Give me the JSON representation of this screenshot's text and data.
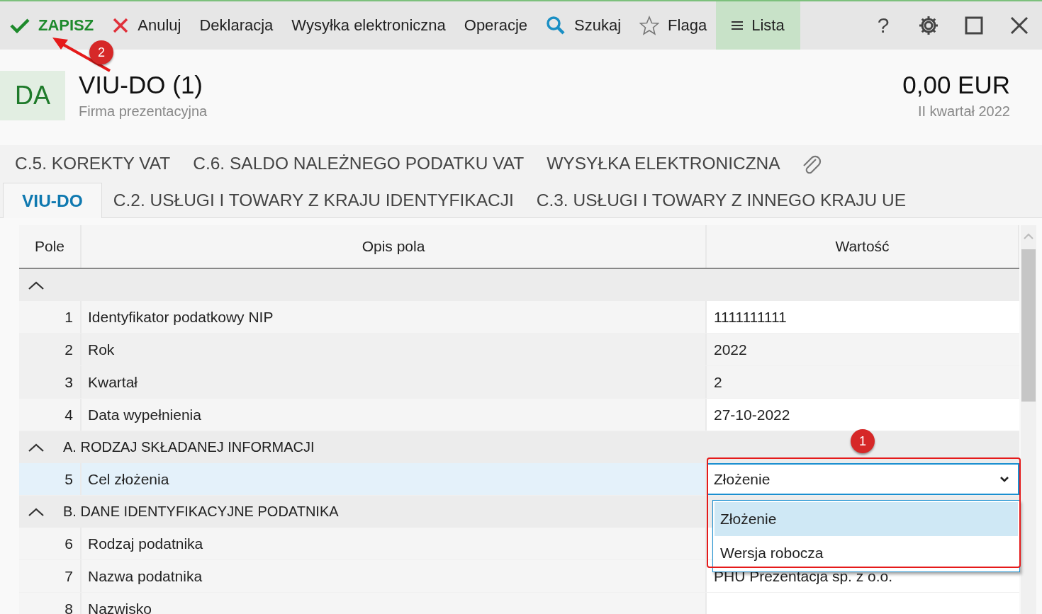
{
  "toolbar": {
    "items": [
      {
        "kind": "save",
        "label": "ZAPISZ",
        "selected": false
      },
      {
        "kind": "cancel",
        "label": "Anuluj",
        "selected": false
      },
      {
        "kind": "plain",
        "label": "Deklaracja",
        "selected": false
      },
      {
        "kind": "plain",
        "label": "Wysyłka elektroniczna",
        "selected": false
      },
      {
        "kind": "plain",
        "label": "Operacje",
        "selected": false
      },
      {
        "kind": "search",
        "label": "Szukaj",
        "selected": false
      },
      {
        "kind": "flag",
        "label": "Flaga",
        "selected": false
      },
      {
        "kind": "list",
        "label": "Lista",
        "selected": true
      }
    ],
    "window_controls": [
      {
        "kind": "help",
        "label": "?"
      },
      {
        "kind": "settings"
      },
      {
        "kind": "maximize"
      },
      {
        "kind": "close"
      }
    ]
  },
  "header": {
    "badge": "DA",
    "title": "VIU-DO (1)",
    "subtitle": "Firma prezentacyjna",
    "amount": "0,00 EUR",
    "period": "II kwartał 2022"
  },
  "tab_rows": [
    {
      "tabs": [
        {
          "label": "C.5. KOREKTY VAT",
          "selected": false
        },
        {
          "label": "C.6. SALDO NALEŻNEGO PODATKU VAT",
          "selected": false
        },
        {
          "label": "WYSYŁKA ELEKTRONICZNA",
          "selected": false
        }
      ],
      "attachment": true
    },
    {
      "tabs": [
        {
          "label": "VIU-DO",
          "selected": true
        },
        {
          "label": "C.2. USŁUGI I TOWARY Z KRAJU IDENTYFIKACJI",
          "selected": false
        },
        {
          "label": "C.3. USŁUGI I TOWARY Z INNEGO KRAJU UE",
          "selected": false
        }
      ]
    }
  ],
  "table": {
    "columns": [
      "Pole",
      "Opis pola",
      "Wartość"
    ],
    "rows": [
      {
        "kind": "group",
        "expanded": true
      },
      {
        "kind": "field",
        "number": "1",
        "label": "Identyfikator podatkowy NIP",
        "value": "1111111111",
        "selected": false
      },
      {
        "kind": "field",
        "number": "2",
        "label": "Rok",
        "value": "2022",
        "selected": false
      },
      {
        "kind": "field",
        "number": "3",
        "label": "Kwartał",
        "value": "2",
        "selected": false
      },
      {
        "kind": "field",
        "number": "4",
        "label": "Data wypełnienia",
        "value": "27-10-2022",
        "selected": false
      },
      {
        "kind": "group",
        "label": "A. RODZAJ SKŁADANEJ INFORMACJI",
        "expanded": true
      },
      {
        "kind": "select",
        "number": "5",
        "label": "Cel złożenia",
        "value": "Złożenie",
        "selected": true,
        "expanded": true,
        "options": [
          {
            "label": "Złożenie",
            "selected": true
          },
          {
            "label": "Wersja robocza",
            "selected": false
          }
        ]
      },
      {
        "kind": "group",
        "label": "B. DANE IDENTYFIKACYJNE PODATNIKA",
        "expanded": true
      },
      {
        "kind": "field",
        "number": "6",
        "label": "Rodzaj podatnika",
        "selected": false
      },
      {
        "kind": "field",
        "number": "7",
        "label": "Nazwa podatnika",
        "value": "PHU Prezentacja sp. z o.o.",
        "selected": false
      },
      {
        "kind": "field",
        "number": "8",
        "label": "Nazwisko",
        "selected": false
      }
    ]
  },
  "annotations": [
    {
      "kind": "dropdown",
      "label": "1"
    },
    {
      "kind": "save",
      "label": "2"
    }
  ]
}
